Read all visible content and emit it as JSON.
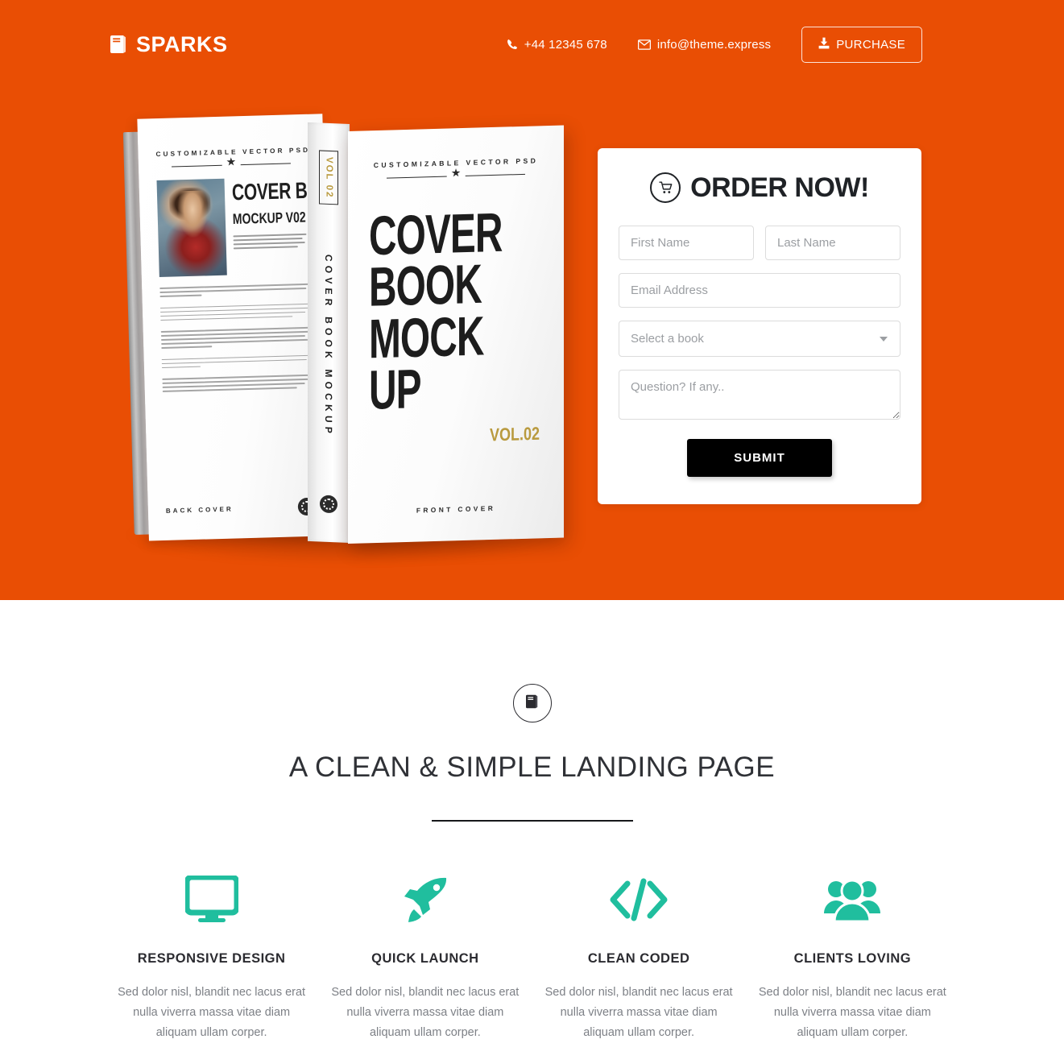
{
  "theme": {
    "brand_orange": "#e94e04",
    "accent_teal": "#20be9e",
    "dark": "#1f2226",
    "muted": "#7d8086"
  },
  "header": {
    "logo_icon": "book-icon",
    "logo_text": "SPARKS",
    "phone_icon": "phone-icon",
    "phone": "+44 12345 678",
    "email_icon": "envelope-icon",
    "email": "info@theme.express",
    "purchase_icon": "download-icon",
    "purchase_label": "PURCHASE"
  },
  "hero": {
    "book_back": {
      "top_text": "CUSTOMIZABLE VECTOR PSD",
      "title_line1": "COVER BOOK",
      "title_line2": "MOCKUP V02",
      "bottom_label": "BACK COVER"
    },
    "book_front": {
      "spine_vol": "VOL 02",
      "spine_title": "COVER BOOK MOCKUP",
      "top_text": "CUSTOMIZABLE VECTOR PSD",
      "title_line1": "COVER",
      "title_line2": "BOOK",
      "title_line3": "MOCK",
      "title_line4": "UP",
      "vol_label": "VOL.02",
      "bottom_label": "FRONT COVER"
    }
  },
  "order_form": {
    "cart_icon": "shopping-cart-icon",
    "title": "ORDER NOW!",
    "first_name_placeholder": "First Name",
    "first_name_value": "",
    "last_name_placeholder": "Last Name",
    "last_name_value": "",
    "email_placeholder": "Email Address",
    "email_value": "",
    "select_placeholder": "Select a book",
    "select_options": [
      "Select a book"
    ],
    "question_placeholder": "Question? If any..",
    "question_value": "",
    "submit_label": "SUBMIT"
  },
  "features_section": {
    "badge_icon": "book-icon",
    "heading": "A CLEAN & SIMPLE LANDING PAGE",
    "items": [
      {
        "icon": "desktop-monitor-icon",
        "title": "RESPONSIVE DESIGN",
        "description": "Sed dolor nisl, blandit nec lacus erat nulla viverra massa vitae diam aliquam ullam corper."
      },
      {
        "icon": "rocket-icon",
        "title": "QUICK LAUNCH",
        "description": "Sed dolor nisl, blandit nec lacus erat nulla viverra massa vitae diam aliquam ullam corper."
      },
      {
        "icon": "code-brackets-icon",
        "title": "CLEAN CODED",
        "description": "Sed dolor nisl, blandit nec lacus erat nulla viverra massa vitae diam aliquam ullam corper."
      },
      {
        "icon": "users-group-icon",
        "title": "CLIENTS LOVING",
        "description": "Sed dolor nisl, blandit nec lacus erat nulla viverra massa vitae diam aliquam ullam corper."
      }
    ]
  }
}
